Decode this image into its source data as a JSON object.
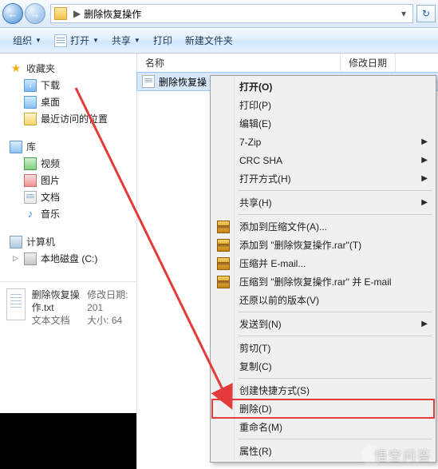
{
  "nav": {
    "back_glyph": "←",
    "fwd_glyph": "→",
    "sep": "▶",
    "location": "删除恢复操作",
    "drop": "▾",
    "refresh": "↻"
  },
  "toolbar": {
    "organize": "组织",
    "open": "打开",
    "share": "共享",
    "print": "打印",
    "newfolder": "新建文件夹",
    "caret": "▼"
  },
  "sidebar": {
    "fav": {
      "label": "收藏夹",
      "star": "★",
      "items": [
        "下载",
        "桌面",
        "最近访问的位置"
      ]
    },
    "lib": {
      "label": "库",
      "items": [
        "视频",
        "图片",
        "文档",
        "音乐"
      ],
      "music_glyph": "♪"
    },
    "comp": {
      "label": "计算机",
      "drive": "本地磁盘 (C:)"
    }
  },
  "details": {
    "name": "删除恢复操作.txt",
    "type": "文本文档",
    "mod_label": "修改日期:",
    "mod_value": "201",
    "size_label": "大小:",
    "size_value": "64 "
  },
  "columns": {
    "name": "名称",
    "date": "修改日期"
  },
  "file": {
    "name": "删除恢复操"
  },
  "ctx": {
    "open": "打开(O)",
    "print": "打印(P)",
    "edit": "编辑(E)",
    "sevenzip": "7-Zip",
    "crcsha": "CRC SHA",
    "openwith": "打开方式(H)",
    "share": "共享(H)",
    "addzip": "添加到压缩文件(A)...",
    "addzip2": "添加到 \"删除恢复操作.rar\"(T)",
    "zipmail": "压缩并 E-mail...",
    "zipmail2": "压缩到 \"删除恢复操作.rar\" 并 E-mail",
    "restore": "还原以前的版本(V)",
    "sendto": "发送到(N)",
    "cut": "剪切(T)",
    "copy": "复制(C)",
    "shortcut": "创建快捷方式(S)",
    "delete": "删除(D)",
    "rename": "重命名(M)",
    "props": "属性(R)",
    "arrow": "▶"
  },
  "watermark": "悟空问答"
}
